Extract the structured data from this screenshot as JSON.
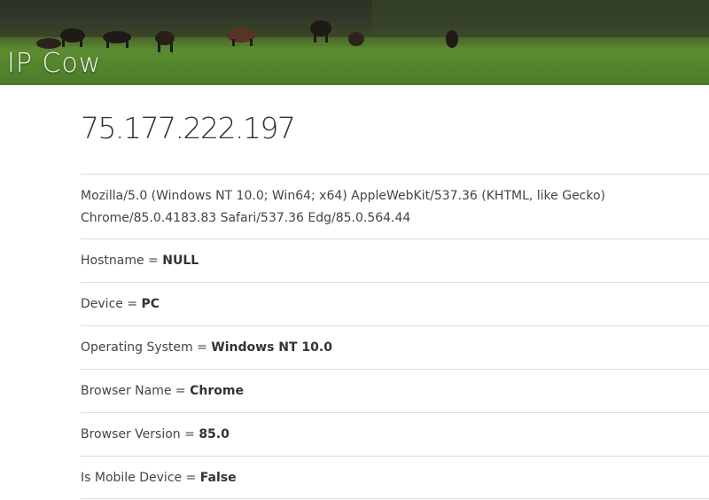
{
  "header": {
    "logo_text": "IP Cow"
  },
  "ip_address": "75.177.222.197",
  "user_agent": {
    "line1": "Mozilla/5.0 (Windows NT 10.0; Win64; x64) AppleWebKit/537.36 (KHTML, like Gecko)",
    "line2": "Chrome/85.0.4183.83 Safari/537.36 Edg/85.0.564.44"
  },
  "details": [
    {
      "label": "Hostname",
      "sep": " = ",
      "value": "NULL"
    },
    {
      "label": "Device",
      "sep": " = ",
      "value": "PC"
    },
    {
      "label": "Operating System",
      "sep": " = ",
      "value": "Windows NT 10.0"
    },
    {
      "label": "Browser Name",
      "sep": " = ",
      "value": "Chrome"
    },
    {
      "label": "Browser Version",
      "sep": " = ",
      "value": "85.0"
    },
    {
      "label": "Is Mobile Device",
      "sep": " = ",
      "value": "False"
    }
  ]
}
